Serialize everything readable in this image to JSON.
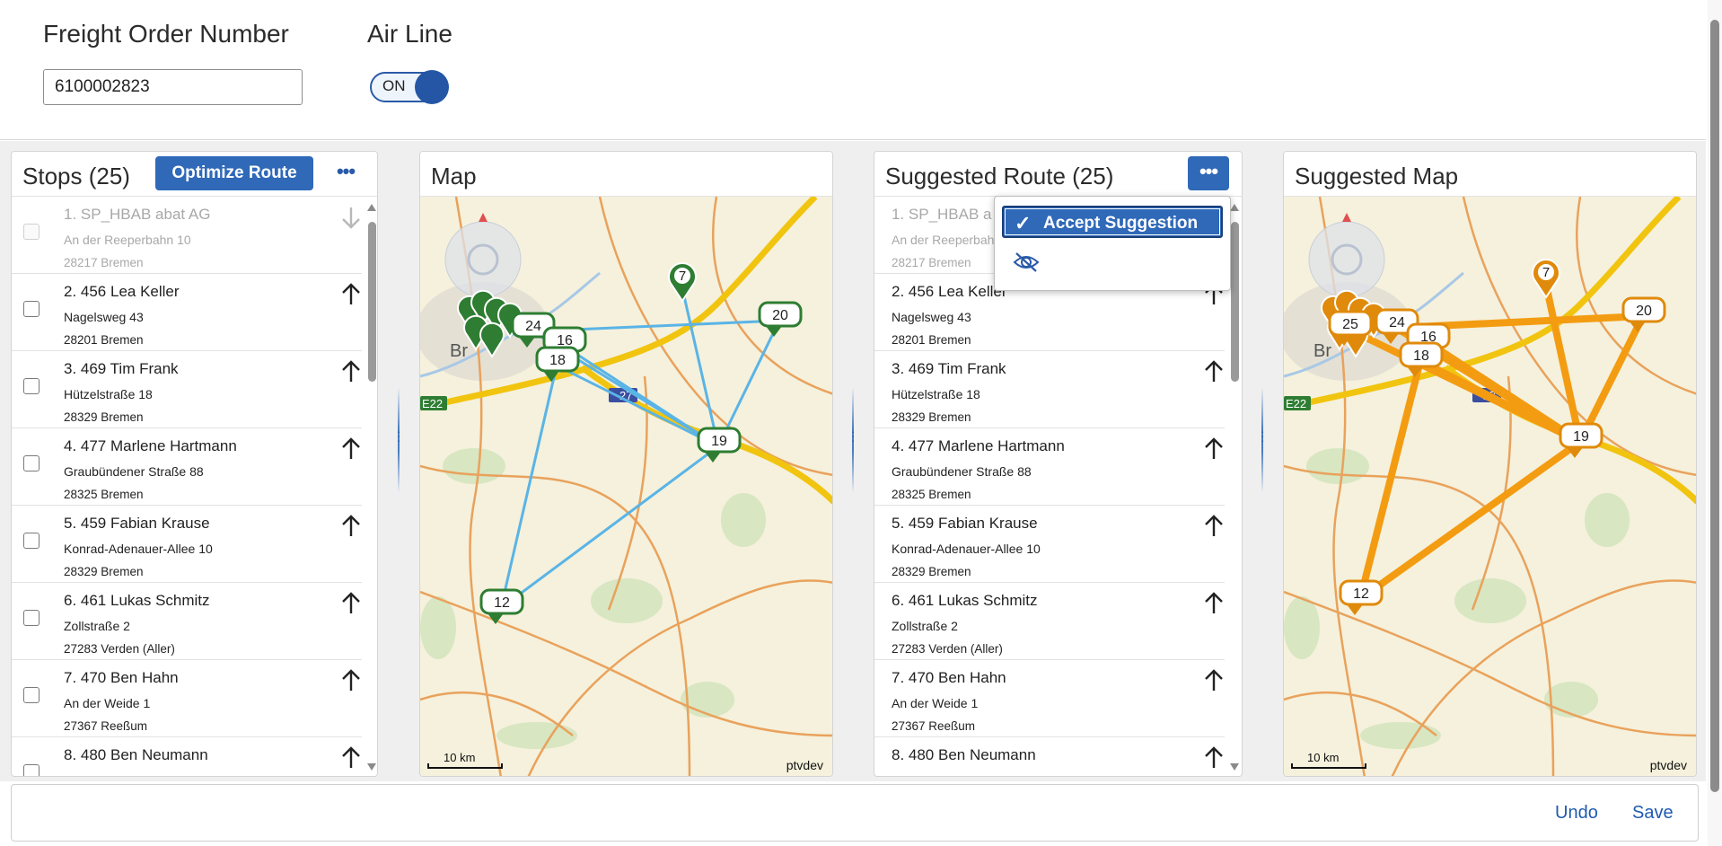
{
  "header": {
    "freight_order_label": "Freight Order Number",
    "freight_order_value": "6100002823",
    "air_line_label": "Air Line",
    "air_line_state": "ON"
  },
  "stops_panel": {
    "title": "Stops (25)",
    "optimize_label": "Optimize Route",
    "more_label": "•••",
    "items": [
      {
        "name": "1. SP_HBAB   abat AG",
        "street": "An der Reeperbahn 10",
        "city": "28217 Bremen"
      },
      {
        "name": "2. 456   Lea Keller",
        "street": "Nagelsweg 43",
        "city": "28201 Bremen"
      },
      {
        "name": "3. 469   Tim Frank",
        "street": "Hützelstraße 18",
        "city": "28329 Bremen"
      },
      {
        "name": "4. 477   Marlene Hartmann",
        "street": "Graubündener Straße 88",
        "city": "28325 Bremen"
      },
      {
        "name": "5. 459   Fabian Krause",
        "street": "Konrad-Adenauer-Allee 10",
        "city": "28329 Bremen"
      },
      {
        "name": "6. 461   Lukas Schmitz",
        "street": "Zollstraße 2",
        "city": "27283 Verden (Aller)"
      },
      {
        "name": "7. 470   Ben Hahn",
        "street": "An der Weide 1",
        "city": "27367 Reeßum"
      },
      {
        "name": "8. 480   Ben Neumann",
        "street": "",
        "city": ""
      }
    ]
  },
  "map_panel": {
    "title": "Map",
    "credit": "ptvdev",
    "scale": "10 km",
    "road_labels": [
      "E22",
      "27"
    ],
    "city_label": "Br",
    "markers": [
      "24",
      "16",
      "18",
      "7",
      "20",
      "19",
      "12"
    ]
  },
  "suggested_panel": {
    "title": "Suggested Route (25)",
    "more_label": "•••",
    "items": [
      {
        "name": "1. SP_HBAB   a",
        "street": "An der Reeperbah",
        "city": "28217 Bremen"
      },
      {
        "name": "2. 456   Lea Keller",
        "street": "Nagelsweg 43",
        "city": "28201 Bremen"
      },
      {
        "name": "3. 469   Tim Frank",
        "street": "Hützelstraße 18",
        "city": "28329 Bremen"
      },
      {
        "name": "4. 477   Marlene Hartmann",
        "street": "Graubündener Straße 88",
        "city": "28325 Bremen"
      },
      {
        "name": "5. 459   Fabian Krause",
        "street": "Konrad-Adenauer-Allee 10",
        "city": "28329 Bremen"
      },
      {
        "name": "6. 461   Lukas Schmitz",
        "street": "Zollstraße 2",
        "city": "27283 Verden (Aller)"
      },
      {
        "name": "7. 470   Ben Hahn",
        "street": "An der Weide 1",
        "city": "27367 Reeßum"
      },
      {
        "name": "8. 480   Ben Neumann",
        "street": "",
        "city": ""
      }
    ],
    "popover": {
      "accept_label": "Accept Suggestion",
      "hide_icon": "eye-slash-icon"
    }
  },
  "suggested_map_panel": {
    "title": "Suggested Map",
    "credit": "ptvdev",
    "scale": "10 km",
    "road_labels": [
      "E22",
      "27"
    ],
    "city_label": "Br",
    "markers": [
      "25",
      "24",
      "16",
      "18",
      "7",
      "20",
      "19",
      "12"
    ]
  },
  "footer": {
    "undo_label": "Undo",
    "save_label": "Save"
  },
  "colors": {
    "accent": "#2f69b8",
    "route_line": "#5ab4e6",
    "route_marker": "#2e7d32",
    "suggested_line": "#f39c12",
    "suggested_marker": "#e08a0b"
  }
}
